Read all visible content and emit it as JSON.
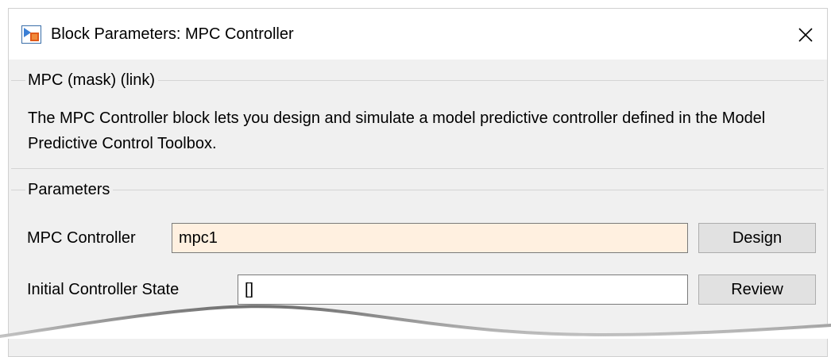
{
  "window": {
    "title": "Block Parameters: MPC Controller"
  },
  "mask_group": {
    "label": "MPC (mask) (link)",
    "description": "The MPC Controller block lets you design and simulate a model predictive controller defined in the Model Predictive Control Toolbox."
  },
  "parameters_group": {
    "label": "Parameters",
    "rows": [
      {
        "label": "MPC Controller",
        "value": "mpc1",
        "button": "Design"
      },
      {
        "label": "Initial Controller State",
        "value": "[]",
        "button": "Review"
      }
    ]
  },
  "colors": {
    "window_bg": "#f0f0f0",
    "titlebar_bg": "#ffffff",
    "highlighted_field_bg": "#fff0e0",
    "field_bg": "#ffffff",
    "button_bg": "#e1e1e1"
  },
  "icons": {
    "app": "simulink-block-icon",
    "close": "close-icon"
  }
}
